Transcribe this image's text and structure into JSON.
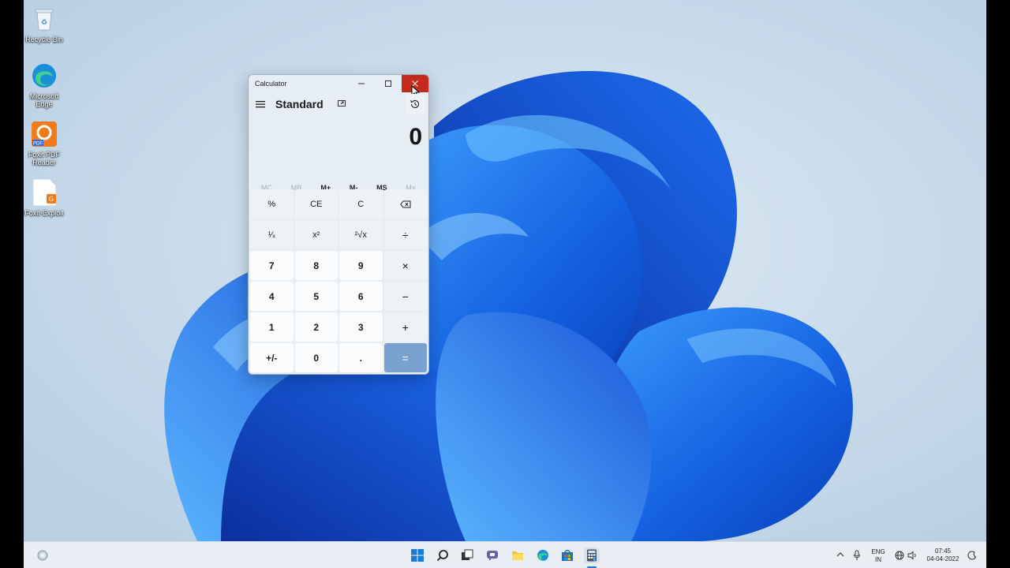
{
  "desktop": {
    "icons": [
      {
        "label": "Recycle Bin",
        "icon": "recycle-bin-icon"
      },
      {
        "label": "Microsoft Edge",
        "icon": "edge-icon"
      },
      {
        "label": "Foxit PDF Reader",
        "icon": "foxit-pdf-reader-icon"
      },
      {
        "label": "Foxit-Exploit",
        "icon": "pdf-file-icon"
      }
    ]
  },
  "calculator": {
    "window_title": "Calculator",
    "mode": "Standard",
    "display_value": "0",
    "memory": [
      "MC",
      "MR",
      "M+",
      "M-",
      "MS",
      "M˅"
    ],
    "memory_enabled": [
      false,
      false,
      true,
      true,
      true,
      false
    ],
    "keys": [
      [
        "%",
        "CE",
        "C",
        "⌫"
      ],
      [
        "¹⁄ₓ",
        "x²",
        "²√x",
        "÷"
      ],
      [
        "7",
        "8",
        "9",
        "×"
      ],
      [
        "4",
        "5",
        "6",
        "−"
      ],
      [
        "1",
        "2",
        "3",
        "+"
      ],
      [
        "+/-",
        "0",
        ".",
        "="
      ]
    ],
    "accent_color": "#7ba2cf"
  },
  "taskbar": {
    "apps": [
      "start-icon",
      "search-icon",
      "task-view-icon",
      "chat-icon",
      "file-explorer-icon",
      "edge-icon",
      "store-icon",
      "calculator-icon"
    ],
    "language": "ENG",
    "region": "IN",
    "time": "07:45",
    "date": "04-04-2022"
  }
}
